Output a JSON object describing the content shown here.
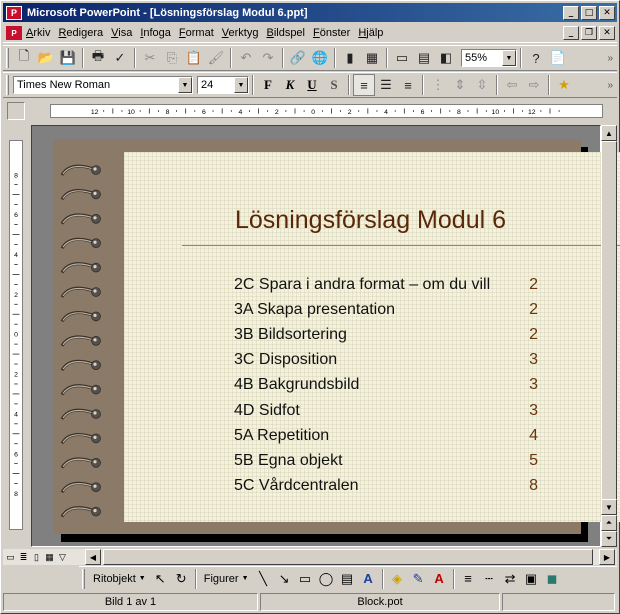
{
  "window": {
    "title": "Microsoft PowerPoint - [Lösningsförslag Modul 6.ppt]",
    "buttons": [
      "minimize",
      "maximize",
      "close"
    ]
  },
  "menubar": {
    "items": [
      "Arkiv",
      "Redigera",
      "Visa",
      "Infoga",
      "Format",
      "Verktyg",
      "Bildspel",
      "Fönster",
      "Hjälp"
    ],
    "doc_buttons": [
      "minimize",
      "restore",
      "close"
    ]
  },
  "standard_toolbar": {
    "zoom": "55%"
  },
  "formatting_toolbar": {
    "font": "Times New Roman",
    "size": "24",
    "bold": "F",
    "italic": "K",
    "underline": "U",
    "shadow": "S"
  },
  "rulers": {
    "horizontal_ticks": [
      "12",
      "10",
      "8",
      "6",
      "4",
      "2",
      "0",
      "2",
      "4",
      "6",
      "8",
      "10",
      "12"
    ],
    "vertical_ticks": [
      "8",
      "6",
      "4",
      "2",
      "0",
      "2",
      "4",
      "6",
      "8"
    ]
  },
  "slide": {
    "title": "Lösningsförslag Modul 6",
    "entries": [
      {
        "label": "2C Spara i andra format – om du vill",
        "page": "2"
      },
      {
        "label": "3A Skapa presentation",
        "page": "2"
      },
      {
        "label": "3B Bildsortering",
        "page": "2"
      },
      {
        "label": "3C Disposition",
        "page": "3"
      },
      {
        "label": "4B Bakgrundsbild",
        "page": "3"
      },
      {
        "label": "4D Sidfot",
        "page": "3"
      },
      {
        "label": "5A Repetition",
        "page": "4"
      },
      {
        "label": "5B Egna objekt",
        "page": "5"
      },
      {
        "label": "5C Vårdcentralen",
        "page": "8"
      }
    ],
    "colors": {
      "frame": "#8c7a68",
      "paper": "#f4f2dd",
      "title": "#5a2608"
    }
  },
  "drawing_toolbar": {
    "draw_menu": "Ritobjekt",
    "autoshapes_menu": "Figurer"
  },
  "statusbar": {
    "slide": "Bild 1 av 1",
    "template": "Block.pot"
  }
}
